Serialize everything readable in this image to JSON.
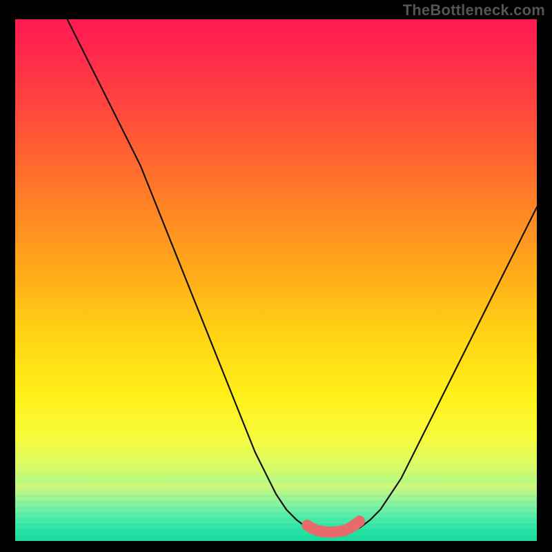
{
  "watermark": "TheBottleneck.com",
  "chart_data": {
    "type": "line",
    "title": "",
    "xlabel": "",
    "ylabel": "",
    "xlim": [
      0,
      100
    ],
    "ylim": [
      0,
      100
    ],
    "grid": false,
    "legend": false,
    "series": [
      {
        "name": "left-branch",
        "x": [
          10,
          12,
          14,
          16,
          18,
          20,
          22,
          24,
          26,
          28,
          30,
          32,
          34,
          36,
          38,
          40,
          42,
          44,
          46,
          48,
          50,
          52,
          54,
          56,
          58
        ],
        "values": [
          100,
          96,
          92,
          88,
          84,
          80,
          76,
          72,
          67,
          62,
          57,
          52,
          47,
          42,
          37,
          32,
          27,
          22,
          17,
          13,
          9,
          6,
          4,
          2.5,
          2
        ]
      },
      {
        "name": "right-branch",
        "x": [
          64,
          66,
          68,
          70,
          72,
          74,
          76,
          78,
          80,
          82,
          84,
          86,
          88,
          90,
          92,
          94,
          96,
          98,
          100
        ],
        "values": [
          2,
          2.5,
          4,
          6,
          9,
          12,
          16,
          20,
          24,
          28,
          32,
          36,
          40,
          44,
          48,
          52,
          56,
          60,
          64
        ]
      },
      {
        "name": "optimal-zone",
        "x": [
          56,
          57,
          58,
          59,
          60,
          61,
          62,
          63,
          64,
          65,
          66
        ],
        "values": [
          3,
          2.4,
          2,
          1.8,
          1.7,
          1.7,
          1.8,
          2,
          2.4,
          3,
          3.8
        ]
      }
    ],
    "annotations": [],
    "gradient_stops": [
      {
        "pos": 0,
        "color": "#ff1a52"
      },
      {
        "pos": 18,
        "color": "#ff4a3c"
      },
      {
        "pos": 38,
        "color": "#ff8a23"
      },
      {
        "pos": 60,
        "color": "#ffd213"
      },
      {
        "pos": 80,
        "color": "#f8fb3b"
      },
      {
        "pos": 94,
        "color": "#6af59e"
      },
      {
        "pos": 100,
        "color": "#17eaa0"
      }
    ],
    "bottom_stripes": [
      "#cef77a",
      "#b6f688",
      "#9ef494",
      "#86f19e",
      "#70eea4",
      "#5aeba7",
      "#46e8a8",
      "#34e4a6",
      "#26e0a3",
      "#1bdb9f"
    ]
  }
}
